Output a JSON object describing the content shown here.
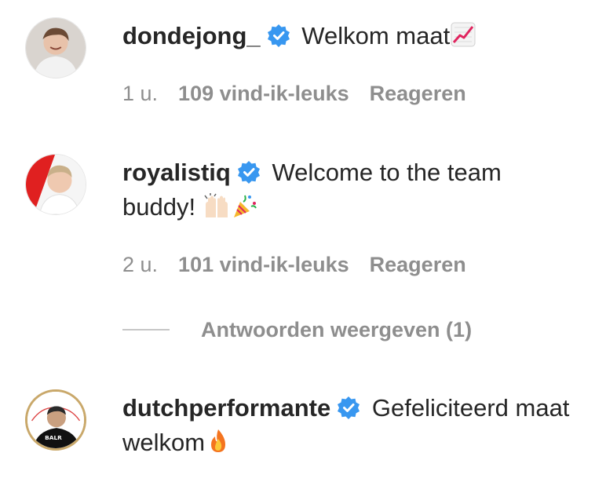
{
  "comments": [
    {
      "username": "dondejong_",
      "text": " Welkom maat",
      "emoji": "chart-increasing-emoji",
      "time": "1 u.",
      "likes": "109 vind-ik-leuks",
      "reply": "Reageren"
    },
    {
      "username": "royalistiq",
      "text": " Welcome to the team buddy! ",
      "emoji": "raising-hands-party-popper-emoji",
      "time": "2 u.",
      "likes": "101 vind-ik-leuks",
      "reply": "Reageren",
      "view_replies": "Antwoorden weergeven (1)"
    },
    {
      "username": "dutchperformante",
      "text": " Gefeliciteerd maat welkom",
      "emoji": "fire-emoji"
    }
  ],
  "colors": {
    "text": "#262626",
    "muted": "#8e8e8e",
    "verified": "#3897f0"
  }
}
